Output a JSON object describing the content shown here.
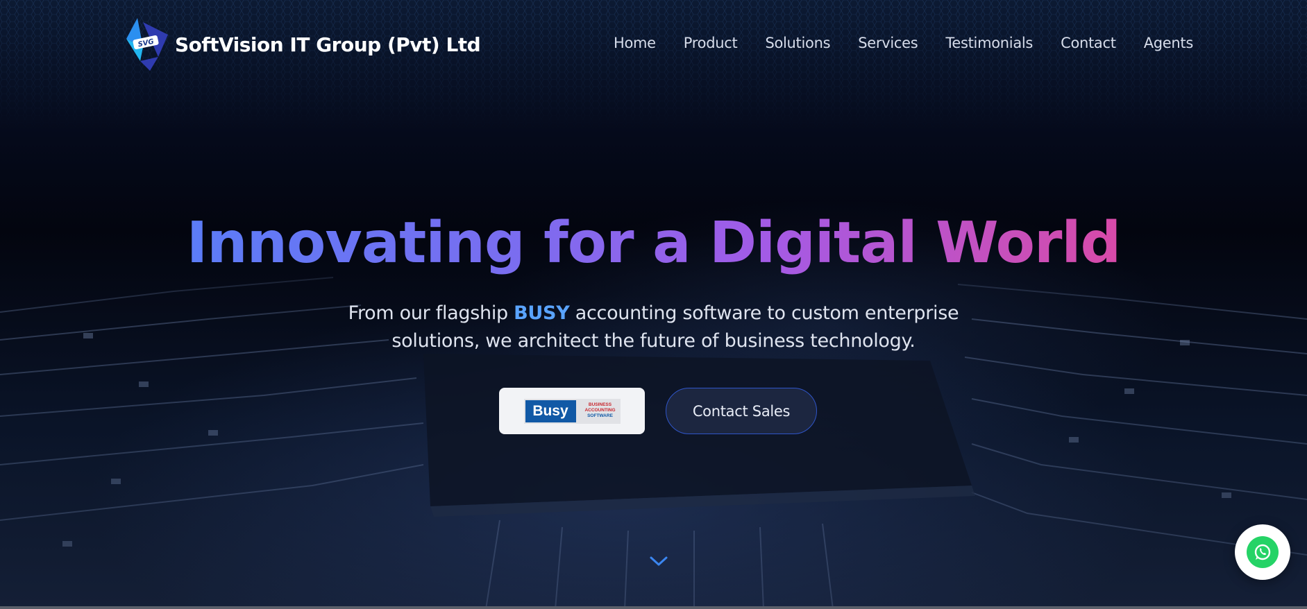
{
  "header": {
    "logo_text": "SVG",
    "brand_name": "SoftVision IT Group (Pvt) Ltd",
    "nav": [
      {
        "label": "Home",
        "icon": null
      },
      {
        "label": "Product",
        "icon": null
      },
      {
        "label": "Solutions",
        "icon": null
      },
      {
        "label": "Services",
        "icon": null
      },
      {
        "label": "Testimonials",
        "icon": null
      },
      {
        "label": "Contact",
        "icon": null
      },
      {
        "label": "Agents",
        "icon": null
      }
    ]
  },
  "hero": {
    "title": "Innovating for a Digital World",
    "subtitle_before": "From our flagship ",
    "subtitle_accent": "BUSY",
    "subtitle_after": " accounting software to custom enterprise solutions, we architect the future of business technology.",
    "busy_button": {
      "logo_word": "Busy",
      "logo_line1": "BUSINESS",
      "logo_line2": "ACCOUNTING",
      "logo_line3": "SOFTWARE"
    },
    "contact_button_label": "Contact Sales",
    "scroll_icon": "chevron-down-icon"
  },
  "floating": {
    "whatsapp_icon": "whatsapp-icon"
  },
  "colors": {
    "gradient_start": "#5b7cf7",
    "gradient_end": "#d84aa8",
    "accent_blue": "#5aa4ff",
    "whatsapp_green": "#25d366",
    "busy_blue": "#1159a6",
    "busy_red": "#c8262d"
  }
}
